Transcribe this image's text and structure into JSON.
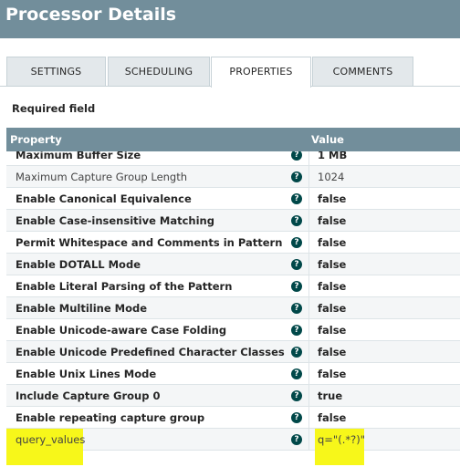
{
  "header": {
    "title": "Processor Details"
  },
  "tabs": [
    {
      "label": "SETTINGS"
    },
    {
      "label": "SCHEDULING"
    },
    {
      "label": "PROPERTIES"
    },
    {
      "label": "COMMENTS"
    }
  ],
  "active_tab": "PROPERTIES",
  "required_field_label": "Required field",
  "grid": {
    "columns": {
      "property": "Property",
      "value": "Value"
    },
    "rows": [
      {
        "name": "Maximum Buffer Size",
        "value": "1 MB",
        "bold": true
      },
      {
        "name": "Maximum Capture Group Length",
        "value": "1024",
        "bold": false
      },
      {
        "name": "Enable Canonical Equivalence",
        "value": "false",
        "bold": true
      },
      {
        "name": "Enable Case-insensitive Matching",
        "value": "false",
        "bold": true
      },
      {
        "name": "Permit Whitespace and Comments in Pattern",
        "value": "false",
        "bold": true
      },
      {
        "name": "Enable DOTALL Mode",
        "value": "false",
        "bold": true
      },
      {
        "name": "Enable Literal Parsing of the Pattern",
        "value": "false",
        "bold": true
      },
      {
        "name": "Enable Multiline Mode",
        "value": "false",
        "bold": true
      },
      {
        "name": "Enable Unicode-aware Case Folding",
        "value": "false",
        "bold": true
      },
      {
        "name": "Enable Unicode Predefined Character Classes",
        "value": "false",
        "bold": true
      },
      {
        "name": "Enable Unix Lines Mode",
        "value": "false",
        "bold": true
      },
      {
        "name": "Include Capture Group 0",
        "value": "true",
        "bold": true
      },
      {
        "name": "Enable repeating capture group",
        "value": "false",
        "bold": true
      },
      {
        "name": "query_values",
        "value": "q=\"(.*?)\"",
        "bold": false,
        "highlight": true
      }
    ],
    "help_icon": "?"
  },
  "colors": {
    "header_bg": "#728e9b",
    "tab_bg": "#e3e8eb",
    "help_icon_bg": "#004849",
    "highlight": "#f7f71a"
  }
}
